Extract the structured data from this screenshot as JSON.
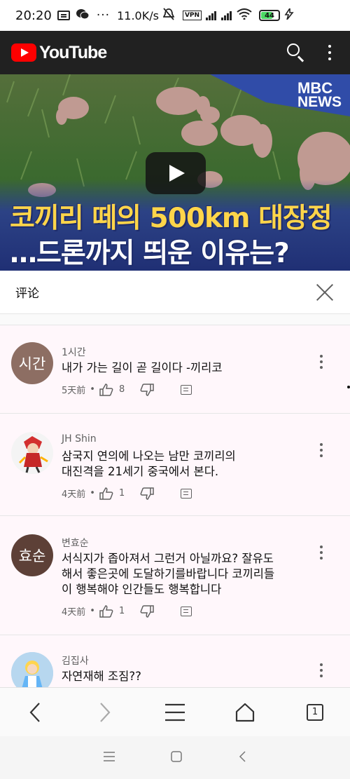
{
  "status_bar": {
    "time": "20:20",
    "network_speed": "11.0K/s",
    "vpn_label": "VPN",
    "battery": "44",
    "icons": [
      "message-icon",
      "wechat-icon",
      "more-dots-icon",
      "alarm-off-icon",
      "vpn-icon",
      "signal-icon",
      "signal-icon",
      "wifi-icon",
      "battery-icon",
      "charging-icon"
    ]
  },
  "header": {
    "brand": "YouTube",
    "brand_color": "#ff0000",
    "icons": [
      "search-icon",
      "more-vertical-icon"
    ]
  },
  "video": {
    "badge_line1": "MBC",
    "badge_line2": "NEWS",
    "headline_line1": "코끼리 떼의 500km 대장정",
    "headline_line2": "…드론까지 띄운 이유는?",
    "play_icon": "play-icon"
  },
  "comments_panel": {
    "title": "评论",
    "close_icon": "close-icon",
    "comments": [
      {
        "avatar_text": "시간",
        "avatar_color": "#8d6e63",
        "author": "1시간",
        "text": "내가  가는 길이 곧 길이다 -끼리코",
        "age": "5天前",
        "likes": "8"
      },
      {
        "avatar_text": "",
        "author": "JH Shin",
        "text": "삼국지 연의에 나오는 남만 코끼리의\n대진격을 21세기 중국에서 본다.",
        "age": "4天前",
        "likes": "1"
      },
      {
        "avatar_text": "효순",
        "avatar_color": "#5d4037",
        "author": "변효순",
        "text": "서식지가 좁아져서 그런거 아닐까요? 잘유도\n해서 좋은곳에 도달하기를바랍니다  코끼리들\n이 행복해야 인간들도 행복합니다",
        "age": "4天前",
        "likes": "1"
      },
      {
        "avatar_text": "",
        "author": "김집사",
        "text": "자연재해 조짐??",
        "age": "",
        "likes": ""
      }
    ]
  },
  "browser_nav": {
    "tab_count": "1",
    "icons": [
      "back-icon",
      "forward-icon",
      "menu-icon",
      "home-icon",
      "tabs-icon"
    ]
  },
  "system_nav": {
    "icons": [
      "recents-icon",
      "home-square-icon",
      "back-arrow-icon"
    ]
  }
}
